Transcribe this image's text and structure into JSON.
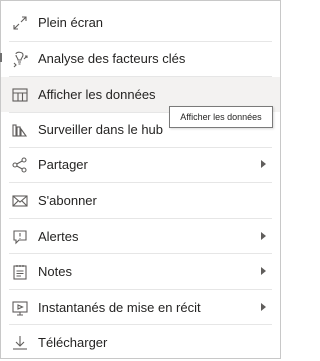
{
  "menu": {
    "items": [
      {
        "label": "Plein écran",
        "icon": "fullscreen-icon",
        "submenu": false
      },
      {
        "label": "Analyse des facteurs clés",
        "icon": "key-influencers-icon",
        "submenu": false
      },
      {
        "label": "Afficher les données",
        "icon": "table-icon",
        "submenu": false,
        "hovered": true
      },
      {
        "label": "Surveiller dans le hub",
        "icon": "hub-icon",
        "submenu": false
      },
      {
        "label": "Partager",
        "icon": "share-icon",
        "submenu": true
      },
      {
        "label": "S'abonner",
        "icon": "mail-icon",
        "submenu": false
      },
      {
        "label": "Alertes",
        "icon": "alert-icon",
        "submenu": true
      },
      {
        "label": "Notes",
        "icon": "notes-icon",
        "submenu": true
      },
      {
        "label": "Instantanés de mise en récit",
        "icon": "snapshot-icon",
        "submenu": true
      },
      {
        "label": "Télécharger",
        "icon": "download-icon",
        "submenu": false
      }
    ]
  },
  "tooltip": {
    "text": "Afficher les données"
  },
  "colors": {
    "hover": "#f3f2f1",
    "text": "#252423",
    "icon": "#605e5c"
  }
}
